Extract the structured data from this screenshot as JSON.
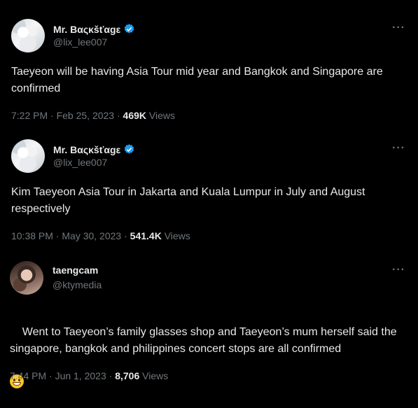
{
  "tweets": [
    {
      "author_name": "Mr. Bαςκšťαgε",
      "verified": true,
      "handle": "@lix_lee007",
      "more_icon": "more-icon",
      "text": "Taeyeon will be having Asia Tour mid year and Bangkok and Singapore are confirmed",
      "time": "7:22 PM · Feb 25, 2023 ·",
      "views_count": "469K",
      "views_label": "Views"
    },
    {
      "author_name": "Mr. Bαςκšťαgε",
      "verified": true,
      "handle": "@lix_lee007",
      "more_icon": "more-icon",
      "text": "Kim Taeyeon Asia Tour in Jakarta and Kuala Lumpur in July and August respectively",
      "time": "10:38 PM · May 30, 2023 ·",
      "views_count": "541.4K",
      "views_label": "Views"
    },
    {
      "author_name": "taengcam",
      "verified": false,
      "handle": "@ktymedia",
      "more_icon": "more-icon",
      "text": "Went to Taeyeon’s family glasses shop and Taeyeon’s mum herself said the singapore, bangkok and philippines concert stops are all confirmed",
      "emoji": "grinning-face-emoji",
      "time": "7:44 PM · Jun 1, 2023 ·",
      "views_count": "8,706",
      "views_label": "Views"
    }
  ],
  "colors": {
    "background": "#000000",
    "text": "#e7e9ea",
    "secondary": "#71767b",
    "verified": "#1d9bf0"
  }
}
